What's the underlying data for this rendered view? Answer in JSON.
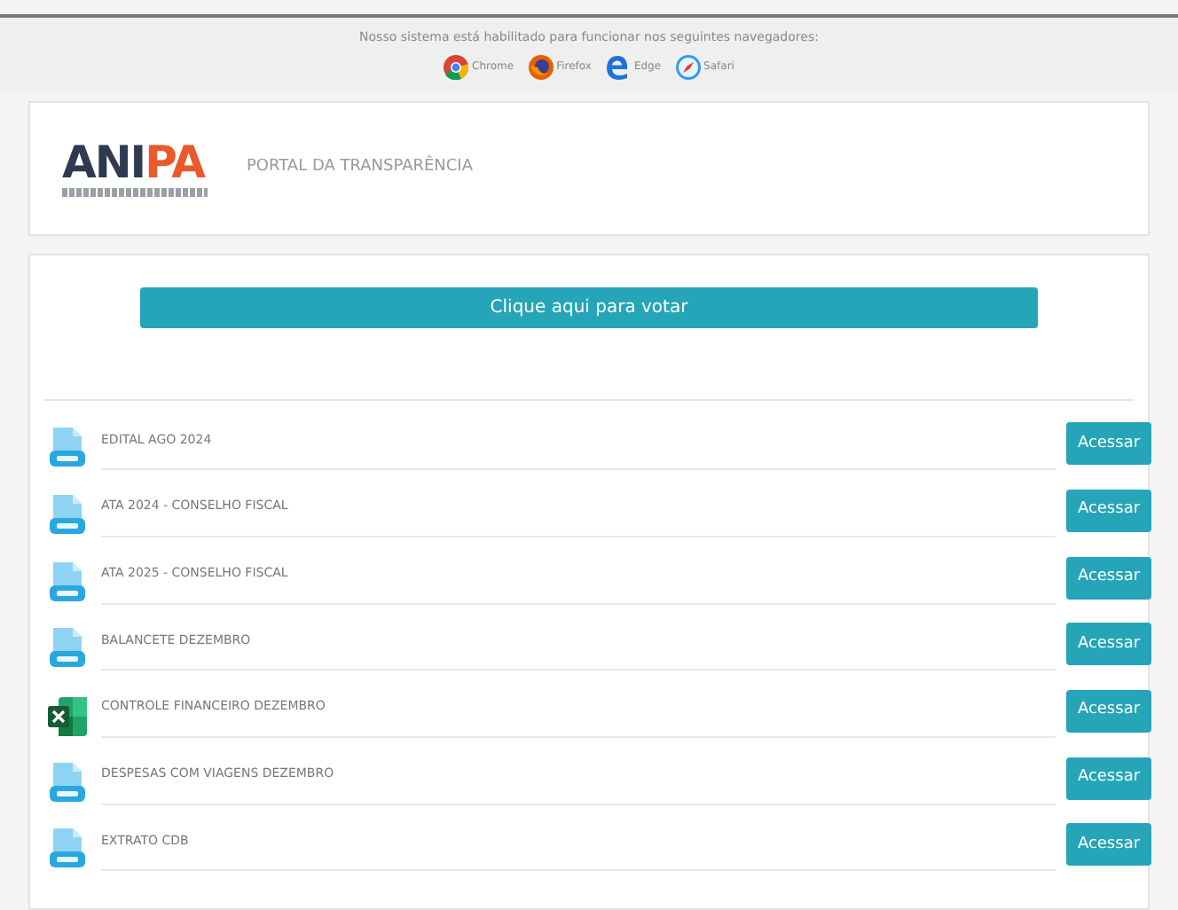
{
  "browser_notice": {
    "text": "Nosso sistema está habilitado para funcionar nos seguintes navegadores:",
    "browsers": [
      {
        "kind": "chrome",
        "label": "Chrome"
      },
      {
        "kind": "firefox",
        "label": "Firefox"
      },
      {
        "kind": "edge",
        "label": "Edge"
      },
      {
        "kind": "safari",
        "label": "Safari"
      }
    ]
  },
  "header": {
    "logo_main": "ANI",
    "logo_accent": "PA",
    "title": "PORTAL DA TRANSPARÊNCIA"
  },
  "vote_button": "Clique aqui para votar",
  "documents": [
    {
      "kind": "pdf",
      "title": "EDITAL AGO 2024",
      "action": "Acessar"
    },
    {
      "kind": "pdf",
      "title": "ATA 2024 - CONSELHO FISCAL",
      "action": "Acessar"
    },
    {
      "kind": "pdf",
      "title": "ATA 2025 - CONSELHO FISCAL",
      "action": "Acessar"
    },
    {
      "kind": "pdf",
      "title": "BALANCETE DEZEMBRO",
      "action": "Acessar"
    },
    {
      "kind": "excel",
      "title": "CONTROLE FINANCEIRO DEZEMBRO",
      "action": "Acessar"
    },
    {
      "kind": "pdf",
      "title": "DESPESAS COM VIAGENS DEZEMBRO",
      "action": "Acessar"
    },
    {
      "kind": "pdf",
      "title": "EXTRATO CDB",
      "action": "Acessar"
    }
  ]
}
